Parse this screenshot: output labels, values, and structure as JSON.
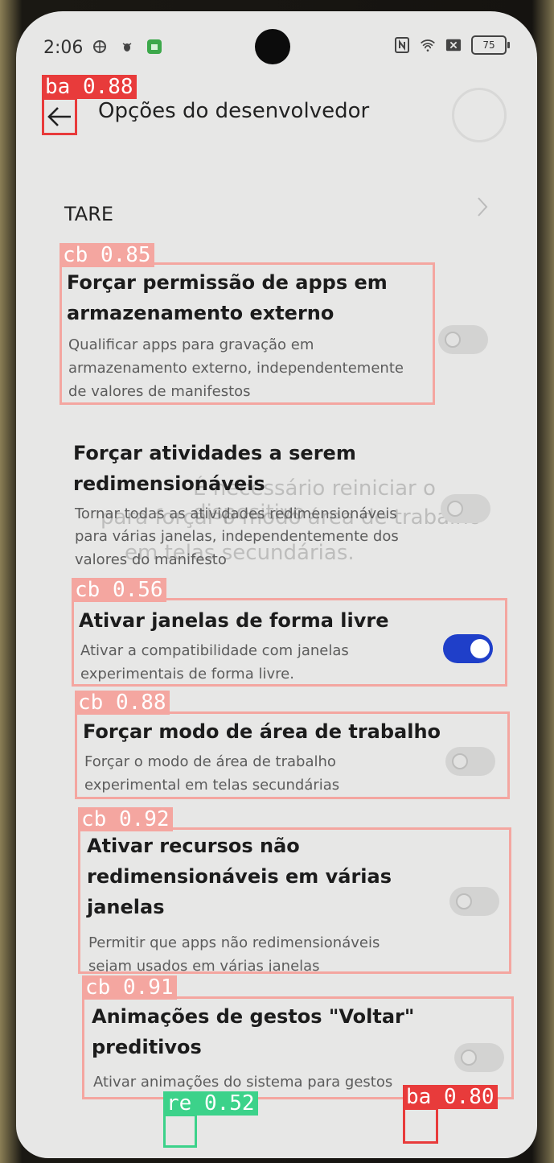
{
  "status": {
    "time": "2:06",
    "battery": "75"
  },
  "header": {
    "title": "Opções do desenvolvedor"
  },
  "section": {
    "label": "TARE"
  },
  "settings": [
    {
      "title_line1": "Forçar permissão de apps em",
      "title_line2": "armazenamento externo",
      "desc_line1": "Qualificar apps para gravação em",
      "desc_line2": "armazenamento externo, independentemente",
      "desc_line3": "de valores de manifestos",
      "enabled": false
    },
    {
      "title_line1": "Forçar atividades a serem",
      "title_line2": "redimensionáveis",
      "desc_line1": "Tornar todas as atividades redimensionáveis",
      "desc_line2": "para várias janelas, independentemente dos",
      "desc_line3": "valores do manifesto",
      "enabled": false
    },
    {
      "title_line1": "Ativar janelas de forma livre",
      "desc_line1": "Ativar a compatibilidade com janelas",
      "desc_line2": "experimentais de forma livre.",
      "enabled": true
    },
    {
      "title_line1": "Forçar modo de área de trabalho",
      "desc_line1": "Forçar o modo de área de trabalho",
      "desc_line2": "experimental em telas secundárias",
      "enabled": false
    },
    {
      "title_line1": "Ativar recursos não",
      "title_line2": "redimensionáveis em várias",
      "title_line3": "janelas",
      "desc_line1": "Permitir que apps não redimensionáveis",
      "desc_line2": "sejam usados em várias janelas",
      "enabled": false
    },
    {
      "title_line1": "Animações de gestos \"Voltar\"",
      "title_line2": "preditivos",
      "desc_line1": "Ativar animações do sistema para gestos",
      "enabled": false
    }
  ],
  "ghost_dialog": {
    "line1": "É necessário reiniciar o dispositivo",
    "line2": "para forçar o modo área de trabalho",
    "line3": "em telas secundárias."
  },
  "detections": [
    {
      "label": "ba 0.88",
      "color": "#e83b3b"
    },
    {
      "label": "cb 0.85",
      "color": "#f4a6a0"
    },
    {
      "label": "cb 0.56",
      "color": "#f4a6a0"
    },
    {
      "label": "cb 0.88",
      "color": "#f4a6a0"
    },
    {
      "label": "cb 0.92",
      "color": "#f4a6a0"
    },
    {
      "label": "cb 0.91",
      "color": "#f4a6a0"
    },
    {
      "label": "re 0.52",
      "color": "#3cd28a"
    },
    {
      "label": "ba 0.80",
      "color": "#e83b3b"
    }
  ]
}
